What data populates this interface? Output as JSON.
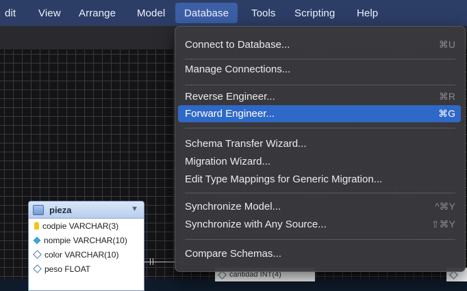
{
  "menubar": {
    "items": [
      "dit",
      "View",
      "Arrange",
      "Model",
      "Database",
      "Tools",
      "Scripting",
      "Help"
    ],
    "active": "Database"
  },
  "dropdown": {
    "items": [
      {
        "label": "Connect to Database...",
        "shortcut": "⌘U"
      },
      {
        "label": "Manage Connections...",
        "shortcut": ""
      },
      {
        "label": "Reverse Engineer...",
        "shortcut": "⌘R"
      },
      {
        "label": "Forward Engineer...",
        "shortcut": "⌘G",
        "highlighted": true
      },
      {
        "label": "Schema Transfer Wizard...",
        "shortcut": ""
      },
      {
        "label": "Migration Wizard...",
        "shortcut": ""
      },
      {
        "label": "Edit Type Mappings for Generic Migration...",
        "shortcut": ""
      },
      {
        "label": "Synchronize Model...",
        "shortcut": "^⌘Y"
      },
      {
        "label": "Synchronize with Any Source...",
        "shortcut": "⇧⌘Y"
      },
      {
        "label": "Compare Schemas...",
        "shortcut": ""
      }
    ]
  },
  "table": {
    "name": "pieza",
    "columns": [
      {
        "text": "codpie VARCHAR(3)",
        "kind": "primary-key"
      },
      {
        "text": "nompie VARCHAR(10)",
        "kind": "not-null"
      },
      {
        "text": "color VARCHAR(10)",
        "kind": "nullable"
      },
      {
        "text": "peso FLOAT",
        "kind": "nullable"
      }
    ]
  },
  "peek": {
    "cantidad": "cantidad INT(4)"
  },
  "colors": {
    "menubar": "#2c3e66",
    "active_menu": "#3d5fa6",
    "highlight": "#2f69c7",
    "dropdown_bg": "#3a3a3e"
  }
}
